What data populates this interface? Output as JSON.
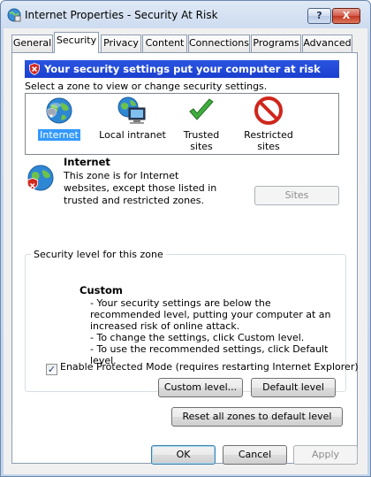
{
  "window": {
    "title": "Internet Properties - Security At Risk",
    "help_label": "?",
    "close_label": "X"
  },
  "tabs": [
    {
      "label": "General"
    },
    {
      "label": "Security",
      "active": true
    },
    {
      "label": "Privacy"
    },
    {
      "label": "Content"
    },
    {
      "label": "Connections"
    },
    {
      "label": "Programs"
    },
    {
      "label": "Advanced"
    }
  ],
  "banner": {
    "text": "Your security settings put your computer at risk",
    "color": "#2146db"
  },
  "zones": {
    "instruction": "Select a zone to view or change security settings.",
    "items": [
      {
        "label": "Internet",
        "icon": "globe-icon",
        "selected": true
      },
      {
        "label": "Local intranet",
        "icon": "intranet-computer-icon"
      },
      {
        "label": "Trusted sites",
        "icon": "green-checkmark-icon"
      },
      {
        "label": "Restricted sites",
        "icon": "restricted-icon",
        "line1": "Restricted",
        "line2": "sites"
      }
    ]
  },
  "selected_zone": {
    "name": "Internet",
    "description": "This zone is for Internet websites, except those listed in trusted and restricted zones.",
    "sites_button": "Sites"
  },
  "security_level": {
    "group_label": "Security level for this zone",
    "level": "Custom",
    "lines": [
      "- Your security settings are below the recommended level, putting your computer at an increased risk of online attack.",
      "- To change the settings, click Custom level.",
      "- To use the recommended settings, click Default level."
    ],
    "protected_mode_label": "Enable Protected Mode (requires restarting Internet Explorer)",
    "protected_mode_checked": true,
    "custom_level_button": "Custom level...",
    "default_level_button": "Default level"
  },
  "reset_button": "Reset all zones to default level",
  "footer": {
    "ok": "OK",
    "cancel": "Cancel",
    "apply": "Apply"
  }
}
